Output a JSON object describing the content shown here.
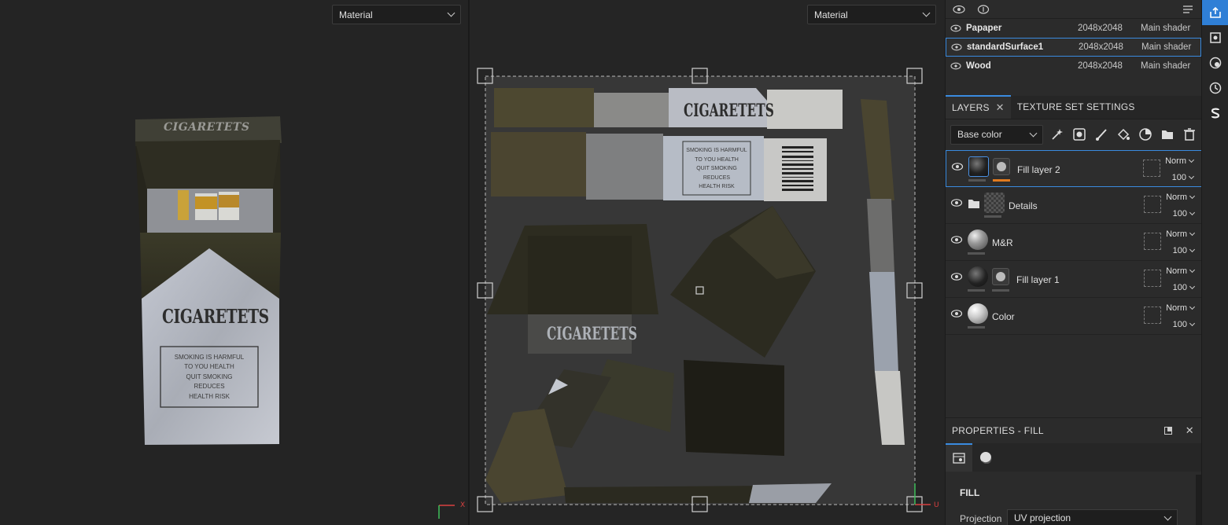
{
  "viewport3d": {
    "material_select": "Material",
    "axis_label": "X",
    "pack_brand_top": "CIGARETETS",
    "pack_brand_front": "CIGARETETS",
    "pack_warning": [
      "SMOKING IS HARMFUL",
      "TO YOU HEALTH",
      "QUIT SMOKING",
      "REDUCES",
      "HEALTH RISK"
    ]
  },
  "viewport2d": {
    "material_select": "Material",
    "axis_label": "U",
    "uv_brand_1": "CIGARETETS",
    "uv_brand_2": "CIGARETETS",
    "uv_warning": [
      "SMOKING IS HARMFUL",
      "TO YOU HEALTH",
      "QUIT SMOKING",
      "REDUCES",
      "HEALTH RISK"
    ]
  },
  "texture_sets": [
    {
      "name": "Papaper",
      "resolution": "2048x2048",
      "shader": "Main shader",
      "selected": false
    },
    {
      "name": "standardSurface1",
      "resolution": "2048x2048",
      "shader": "Main shader",
      "selected": true
    },
    {
      "name": "Wood",
      "resolution": "2048x2048",
      "shader": "Main shader",
      "selected": false
    }
  ],
  "tabs": {
    "layers": "LAYERS",
    "texture_set_settings": "TEXTURE SET SETTINGS"
  },
  "channel_select": "Base color",
  "layers": [
    {
      "name": "Fill layer 2",
      "blend": "Norm",
      "opacity": "100",
      "selected": true,
      "type": "fill-mask"
    },
    {
      "name": "Details",
      "blend": "Norm",
      "opacity": "100",
      "selected": false,
      "type": "folder"
    },
    {
      "name": "M&R",
      "blend": "Norm",
      "opacity": "100",
      "selected": false,
      "type": "sphere"
    },
    {
      "name": "Fill layer 1",
      "blend": "Norm",
      "opacity": "100",
      "selected": false,
      "type": "fill-mask"
    },
    {
      "name": "Color",
      "blend": "Norm",
      "opacity": "100",
      "selected": false,
      "type": "sphere-light"
    }
  ],
  "properties": {
    "title": "PROPERTIES - FILL",
    "section": "FILL",
    "projection_label": "Projection",
    "projection_value": "UV projection"
  },
  "colors": {
    "accent": "#3a8be0",
    "mask_underline": "#e07a1f",
    "panel": "#2b2b2b"
  }
}
